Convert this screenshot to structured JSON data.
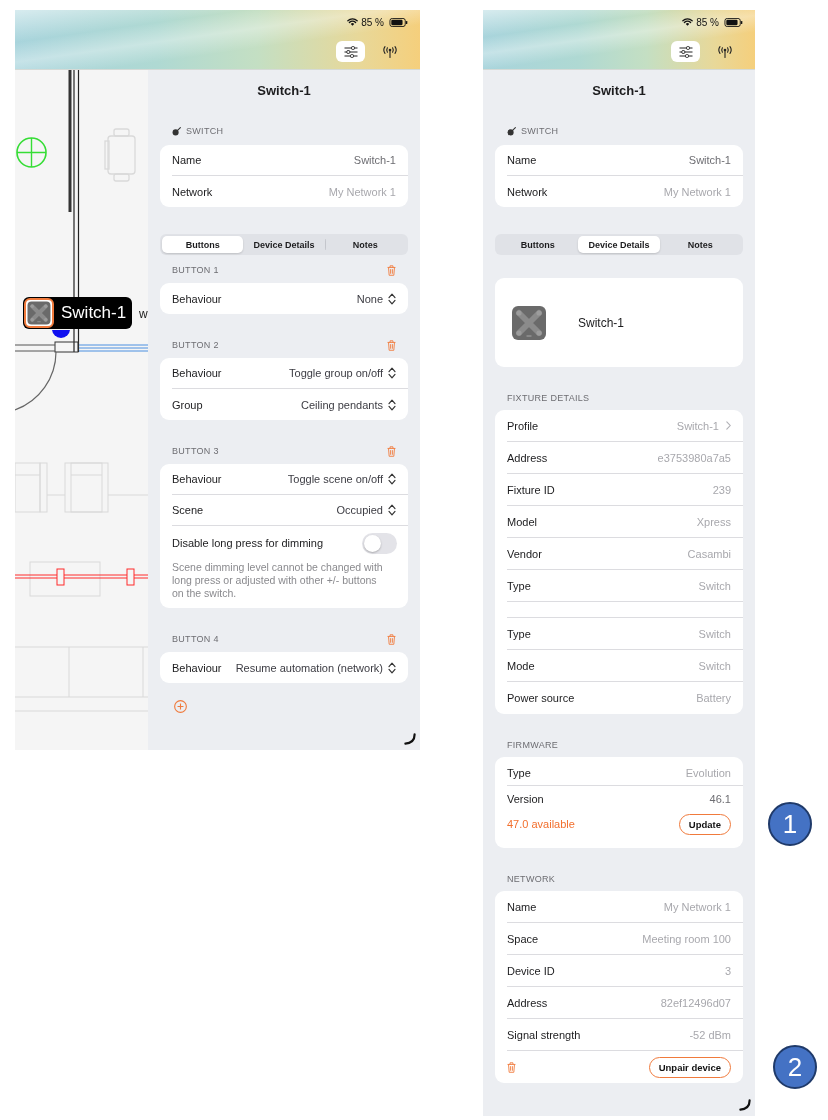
{
  "screens": [
    {
      "status_bar": {
        "battery": "85 %"
      },
      "toolbar": [
        {
          "kind": "sliders",
          "selected": true
        },
        {
          "kind": "antenna",
          "selected": false
        }
      ],
      "floor_plan": {
        "device_tag": "Switch-1",
        "cut_label": "w"
      },
      "panel": {
        "title": "Switch-1",
        "section_label": "SWITCH",
        "info_rows": [
          {
            "label": "Name",
            "value": "Switch-1",
            "muted": false
          },
          {
            "label": "Network",
            "value": "My Network 1",
            "muted": true
          }
        ],
        "tabs": [
          {
            "label": "Buttons",
            "selected": true
          },
          {
            "label": "Device Details",
            "selected": false
          },
          {
            "label": "Notes",
            "selected": false
          }
        ],
        "button_sections": [
          {
            "title": "BUTTON 1",
            "rows": [
              {
                "kind": "picker",
                "label": "Behaviour",
                "value": "None"
              }
            ]
          },
          {
            "title": "BUTTON 2",
            "rows": [
              {
                "kind": "picker",
                "label": "Behaviour",
                "value": "Toggle group on/off"
              },
              {
                "kind": "picker",
                "label": "Group",
                "value": "Ceiling pendants"
              }
            ]
          },
          {
            "title": "BUTTON 3",
            "rows": [
              {
                "kind": "picker",
                "label": "Behaviour",
                "value": "Toggle scene on/off"
              },
              {
                "kind": "picker",
                "label": "Scene",
                "value": "Occupied"
              },
              {
                "kind": "toggle",
                "label": "Disable long press for dimming",
                "on": false,
                "note": "Scene dimming level cannot be changed with long press or adjusted with other +/- buttons on the switch."
              }
            ]
          },
          {
            "title": "BUTTON 4",
            "rows": [
              {
                "kind": "picker",
                "label": "Behaviour",
                "value": "Resume automation (network)"
              }
            ]
          }
        ]
      }
    },
    {
      "status_bar": {
        "battery": "85 %"
      },
      "toolbar": [
        {
          "kind": "sliders",
          "selected": true
        },
        {
          "kind": "antenna",
          "selected": false
        }
      ],
      "panel": {
        "title": "Switch-1",
        "section_label": "SWITCH",
        "info_rows": [
          {
            "label": "Name",
            "value": "Switch-1",
            "muted": false
          },
          {
            "label": "Network",
            "value": "My Network 1",
            "muted": true
          }
        ],
        "tabs": [
          {
            "label": "Buttons",
            "selected": false
          },
          {
            "label": "Device Details",
            "selected": true
          },
          {
            "label": "Notes",
            "selected": false
          }
        ],
        "device_card": {
          "name": "Switch-1"
        },
        "detail_sections": [
          {
            "title": "FIXTURE DETAILS",
            "kind": "list",
            "rows": [
              {
                "kind": "link",
                "label": "Profile",
                "value": "Switch-1",
                "muted": true
              },
              {
                "kind": "text",
                "label": "Address",
                "value": "e3753980a7a5",
                "muted": true
              },
              {
                "kind": "text",
                "label": "Fixture ID",
                "value": "239",
                "muted": true
              },
              {
                "kind": "text",
                "label": "Model",
                "value": "Xpress",
                "muted": true
              },
              {
                "kind": "text",
                "label": "Vendor",
                "value": "Casambi",
                "muted": true
              },
              {
                "kind": "text",
                "label": "Type",
                "value": "Switch",
                "muted": true
              },
              {
                "kind": "partial"
              },
              {
                "kind": "text",
                "label": "Type",
                "value": "Switch",
                "muted": true
              },
              {
                "kind": "text",
                "label": "Mode",
                "value": "Switch",
                "muted": true
              },
              {
                "kind": "text",
                "label": "Power source",
                "value": "Battery",
                "muted": true
              }
            ]
          },
          {
            "title": "FIRMWARE",
            "kind": "compact",
            "rows": [
              {
                "kind": "text",
                "label": "Type",
                "value": "Evolution",
                "muted": true
              },
              {
                "kind": "text",
                "label": "Version",
                "value": "46.1",
                "muted": false
              },
              {
                "kind": "update",
                "label": "47.0 available",
                "button": "Update",
                "callout": "1"
              }
            ]
          },
          {
            "title": "NETWORK",
            "kind": "list",
            "rows": [
              {
                "kind": "text",
                "label": "Name",
                "value": "My Network 1",
                "muted": true
              },
              {
                "kind": "text",
                "label": "Space",
                "value": "Meeting room 100",
                "muted": true
              },
              {
                "kind": "text",
                "label": "Device ID",
                "value": "3",
                "muted": true
              },
              {
                "kind": "text",
                "label": "Address",
                "value": "82ef12496d07",
                "muted": true
              },
              {
                "kind": "text",
                "label": "Signal strength",
                "value": "-52 dBm",
                "muted": true
              },
              {
                "kind": "action",
                "button": "Unpair device",
                "callout": "2"
              }
            ]
          }
        ]
      }
    }
  ]
}
